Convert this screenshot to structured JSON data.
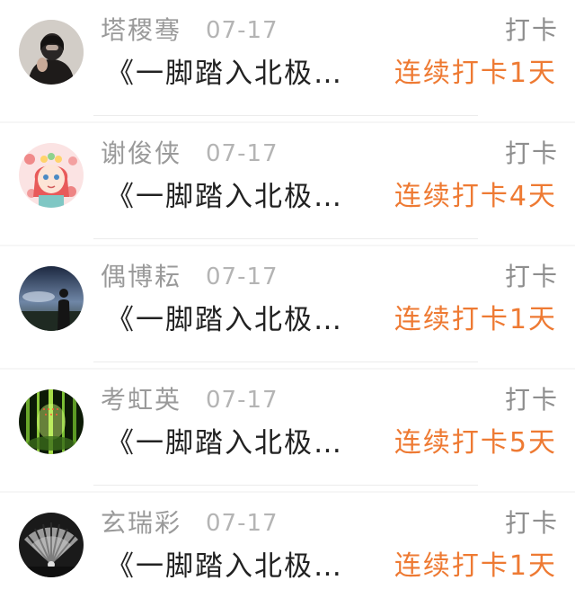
{
  "items": [
    {
      "name": "塔稷骞",
      "date": "07-17",
      "action": "打卡",
      "title": "《一脚踏入北极…",
      "streak": "连续打卡1天",
      "avatar_icon": "person-hood-photo"
    },
    {
      "name": "谢俊侠",
      "date": "07-17",
      "action": "打卡",
      "title": "《一脚踏入北极…",
      "streak": "连续打卡4天",
      "avatar_icon": "cartoon-girl-flowers"
    },
    {
      "name": "偶博耘",
      "date": "07-17",
      "action": "打卡",
      "title": "《一脚踏入北极…",
      "streak": "连续打卡1天",
      "avatar_icon": "man-silhouette-sky"
    },
    {
      "name": "考虹英",
      "date": "07-17",
      "action": "打卡",
      "title": "《一脚踏入北极…",
      "streak": "连续打卡5天",
      "avatar_icon": "bamboo-forest"
    },
    {
      "name": "玄瑞彩",
      "date": "07-17",
      "action": "打卡",
      "title": "《一脚踏入北极…",
      "streak": "连续打卡1天",
      "avatar_icon": "monochrome-fan"
    }
  ],
  "colors": {
    "streak": "#ee7a33",
    "name": "#9a9a9a",
    "title": "#222222"
  }
}
